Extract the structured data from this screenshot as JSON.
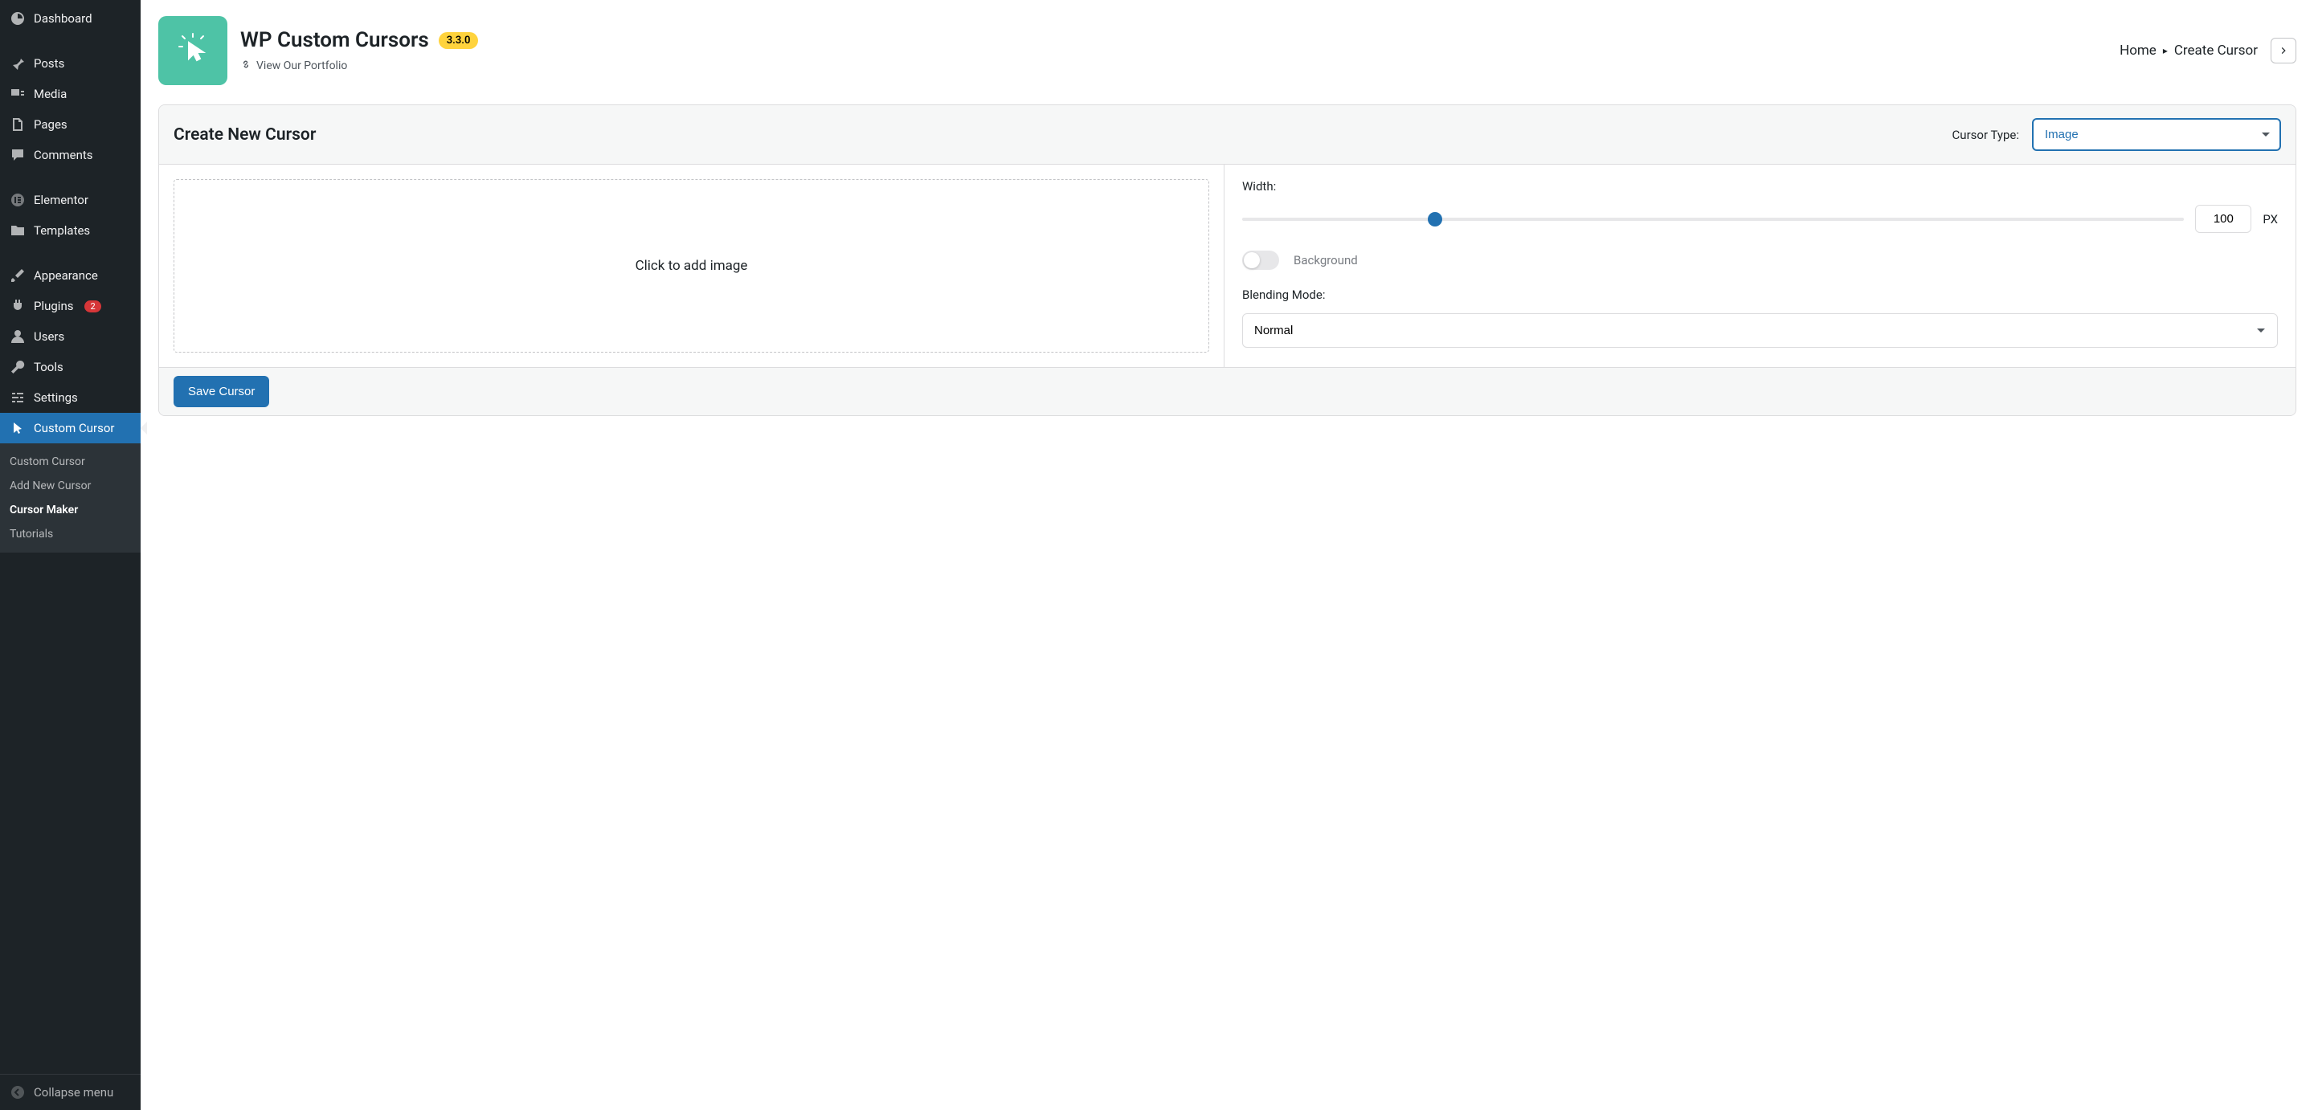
{
  "sidebar": {
    "items": [
      {
        "label": "Dashboard"
      },
      {
        "label": "Posts"
      },
      {
        "label": "Media"
      },
      {
        "label": "Pages"
      },
      {
        "label": "Comments"
      },
      {
        "label": "Elementor"
      },
      {
        "label": "Templates"
      },
      {
        "label": "Appearance"
      },
      {
        "label": "Plugins",
        "badge": "2"
      },
      {
        "label": "Users"
      },
      {
        "label": "Tools"
      },
      {
        "label": "Settings"
      },
      {
        "label": "Custom Cursor"
      }
    ],
    "submenu": [
      {
        "label": "Custom Cursor"
      },
      {
        "label": "Add New Cursor"
      },
      {
        "label": "Cursor Maker"
      },
      {
        "label": "Tutorials"
      }
    ],
    "collapse": "Collapse menu"
  },
  "header": {
    "title": "WP Custom Cursors",
    "version": "3.3.0",
    "portfolio": "View Our Portfolio",
    "breadcrumb_home": "Home",
    "breadcrumb_current": "Create Cursor"
  },
  "card": {
    "title": "Create New Cursor",
    "type_label": "Cursor Type:",
    "type_value": "Image",
    "image_placeholder": "Click to add image",
    "width_label": "Width:",
    "width_value": "100",
    "width_unit": "PX",
    "bg_label": "Background",
    "blend_label": "Blending Mode:",
    "blend_value": "Normal",
    "save_label": "Save Cursor"
  }
}
